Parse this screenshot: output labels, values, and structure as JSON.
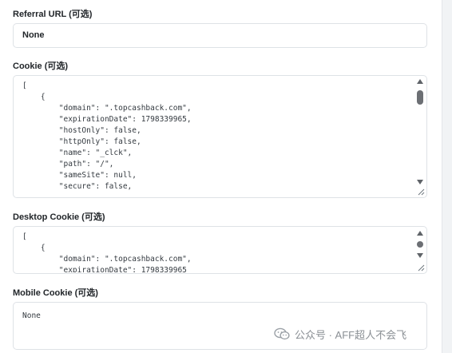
{
  "fields": {
    "referral_url": {
      "label": "Referral URL (可选)",
      "value": "None"
    },
    "cookie": {
      "label": "Cookie (可选)",
      "value": "[\n    {\n        \"domain\": \".topcashback.com\",\n        \"expirationDate\": 1798339965,\n        \"hostOnly\": false,\n        \"httpOnly\": false,\n        \"name\": \"_clck\",\n        \"path\": \"/\",\n        \"sameSite\": null,\n        \"secure\": false,"
    },
    "desktop_cookie": {
      "label": "Desktop Cookie (可选)",
      "value": "[\n    {\n        \"domain\": \".topcashback.com\",\n        \"expirationDate\": 1798339965"
    },
    "mobile_cookie": {
      "label": "Mobile Cookie (可选)",
      "value": "None"
    }
  },
  "watermark": {
    "text": "公众号 · AFF超人不会飞",
    "icon": "wechat-icon"
  }
}
